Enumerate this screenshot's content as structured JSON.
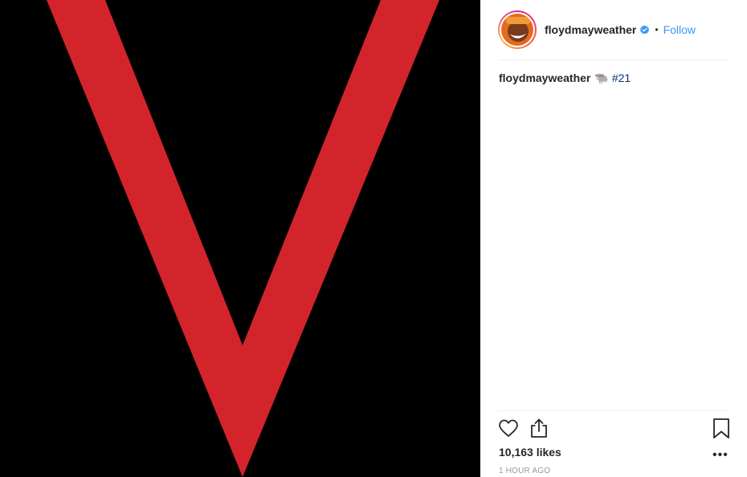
{
  "post": {
    "image": {
      "letter": "V",
      "background_color": "#000000",
      "letter_color": "#d3242b"
    }
  },
  "header": {
    "username": "floydmayweather",
    "verified_icon": "verified-badge-icon",
    "separator": "•",
    "follow_label": "Follow"
  },
  "caption": {
    "username": "floydmayweather",
    "emoji": "🐃",
    "hashtag": "#21"
  },
  "actions": {
    "like_icon": "heart-icon",
    "share_icon": "share-icon",
    "save_icon": "bookmark-icon",
    "more_icon": "more-icon",
    "more_label": "•••"
  },
  "likes": "10,163 likes",
  "timestamp": "1 HOUR AGO",
  "colors": {
    "accent": "#3897f0",
    "text": "#262626",
    "muted": "#999999",
    "hashtag": "#003569"
  }
}
